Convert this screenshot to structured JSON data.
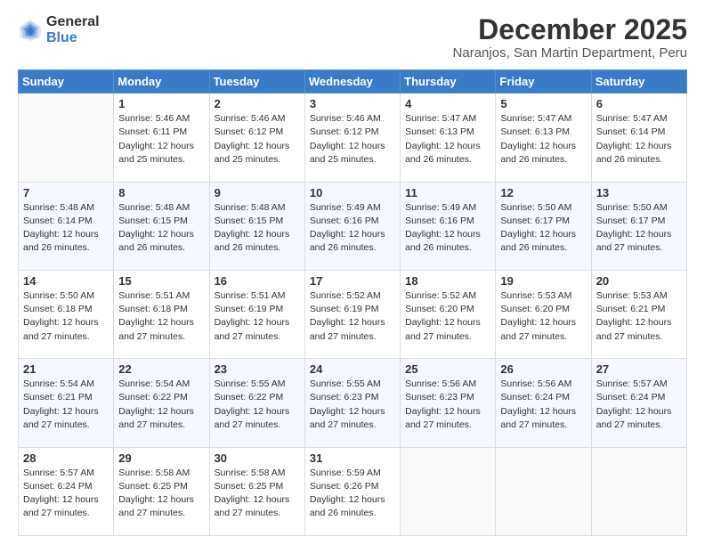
{
  "logo": {
    "general": "General",
    "blue": "Blue"
  },
  "title": "December 2025",
  "subtitle": "Naranjos, San Martin Department, Peru",
  "header_days": [
    "Sunday",
    "Monday",
    "Tuesday",
    "Wednesday",
    "Thursday",
    "Friday",
    "Saturday"
  ],
  "weeks": [
    [
      {
        "day": "",
        "info": ""
      },
      {
        "day": "1",
        "info": "Sunrise: 5:46 AM\nSunset: 6:11 PM\nDaylight: 12 hours\nand 25 minutes."
      },
      {
        "day": "2",
        "info": "Sunrise: 5:46 AM\nSunset: 6:12 PM\nDaylight: 12 hours\nand 25 minutes."
      },
      {
        "day": "3",
        "info": "Sunrise: 5:46 AM\nSunset: 6:12 PM\nDaylight: 12 hours\nand 25 minutes."
      },
      {
        "day": "4",
        "info": "Sunrise: 5:47 AM\nSunset: 6:13 PM\nDaylight: 12 hours\nand 26 minutes."
      },
      {
        "day": "5",
        "info": "Sunrise: 5:47 AM\nSunset: 6:13 PM\nDaylight: 12 hours\nand 26 minutes."
      },
      {
        "day": "6",
        "info": "Sunrise: 5:47 AM\nSunset: 6:14 PM\nDaylight: 12 hours\nand 26 minutes."
      }
    ],
    [
      {
        "day": "7",
        "info": "Sunrise: 5:48 AM\nSunset: 6:14 PM\nDaylight: 12 hours\nand 26 minutes."
      },
      {
        "day": "8",
        "info": "Sunrise: 5:48 AM\nSunset: 6:15 PM\nDaylight: 12 hours\nand 26 minutes."
      },
      {
        "day": "9",
        "info": "Sunrise: 5:48 AM\nSunset: 6:15 PM\nDaylight: 12 hours\nand 26 minutes."
      },
      {
        "day": "10",
        "info": "Sunrise: 5:49 AM\nSunset: 6:16 PM\nDaylight: 12 hours\nand 26 minutes."
      },
      {
        "day": "11",
        "info": "Sunrise: 5:49 AM\nSunset: 6:16 PM\nDaylight: 12 hours\nand 26 minutes."
      },
      {
        "day": "12",
        "info": "Sunrise: 5:50 AM\nSunset: 6:17 PM\nDaylight: 12 hours\nand 26 minutes."
      },
      {
        "day": "13",
        "info": "Sunrise: 5:50 AM\nSunset: 6:17 PM\nDaylight: 12 hours\nand 27 minutes."
      }
    ],
    [
      {
        "day": "14",
        "info": "Sunrise: 5:50 AM\nSunset: 6:18 PM\nDaylight: 12 hours\nand 27 minutes."
      },
      {
        "day": "15",
        "info": "Sunrise: 5:51 AM\nSunset: 6:18 PM\nDaylight: 12 hours\nand 27 minutes."
      },
      {
        "day": "16",
        "info": "Sunrise: 5:51 AM\nSunset: 6:19 PM\nDaylight: 12 hours\nand 27 minutes."
      },
      {
        "day": "17",
        "info": "Sunrise: 5:52 AM\nSunset: 6:19 PM\nDaylight: 12 hours\nand 27 minutes."
      },
      {
        "day": "18",
        "info": "Sunrise: 5:52 AM\nSunset: 6:20 PM\nDaylight: 12 hours\nand 27 minutes."
      },
      {
        "day": "19",
        "info": "Sunrise: 5:53 AM\nSunset: 6:20 PM\nDaylight: 12 hours\nand 27 minutes."
      },
      {
        "day": "20",
        "info": "Sunrise: 5:53 AM\nSunset: 6:21 PM\nDaylight: 12 hours\nand 27 minutes."
      }
    ],
    [
      {
        "day": "21",
        "info": "Sunrise: 5:54 AM\nSunset: 6:21 PM\nDaylight: 12 hours\nand 27 minutes."
      },
      {
        "day": "22",
        "info": "Sunrise: 5:54 AM\nSunset: 6:22 PM\nDaylight: 12 hours\nand 27 minutes."
      },
      {
        "day": "23",
        "info": "Sunrise: 5:55 AM\nSunset: 6:22 PM\nDaylight: 12 hours\nand 27 minutes."
      },
      {
        "day": "24",
        "info": "Sunrise: 5:55 AM\nSunset: 6:23 PM\nDaylight: 12 hours\nand 27 minutes."
      },
      {
        "day": "25",
        "info": "Sunrise: 5:56 AM\nSunset: 6:23 PM\nDaylight: 12 hours\nand 27 minutes."
      },
      {
        "day": "26",
        "info": "Sunrise: 5:56 AM\nSunset: 6:24 PM\nDaylight: 12 hours\nand 27 minutes."
      },
      {
        "day": "27",
        "info": "Sunrise: 5:57 AM\nSunset: 6:24 PM\nDaylight: 12 hours\nand 27 minutes."
      }
    ],
    [
      {
        "day": "28",
        "info": "Sunrise: 5:57 AM\nSunset: 6:24 PM\nDaylight: 12 hours\nand 27 minutes."
      },
      {
        "day": "29",
        "info": "Sunrise: 5:58 AM\nSunset: 6:25 PM\nDaylight: 12 hours\nand 27 minutes."
      },
      {
        "day": "30",
        "info": "Sunrise: 5:58 AM\nSunset: 6:25 PM\nDaylight: 12 hours\nand 27 minutes."
      },
      {
        "day": "31",
        "info": "Sunrise: 5:59 AM\nSunset: 6:26 PM\nDaylight: 12 hours\nand 26 minutes."
      },
      {
        "day": "",
        "info": ""
      },
      {
        "day": "",
        "info": ""
      },
      {
        "day": "",
        "info": ""
      }
    ]
  ]
}
